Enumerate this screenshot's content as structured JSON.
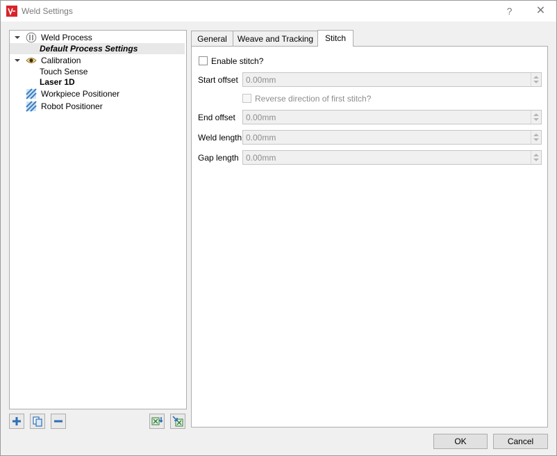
{
  "window": {
    "title": "Weld Settings",
    "help": "?",
    "close": "✕"
  },
  "tree": {
    "items": [
      {
        "label": "Weld Process",
        "icon": "weld-process-icon"
      },
      {
        "label": "Default Process Settings"
      },
      {
        "label": "Calibration",
        "icon": "eye-icon"
      },
      {
        "label": "Touch Sense"
      },
      {
        "label": "Laser 1D"
      },
      {
        "label": "Workpiece Positioner",
        "icon": "positioner-icon"
      },
      {
        "label": "Robot Positioner",
        "icon": "positioner-icon"
      }
    ]
  },
  "tabs": [
    {
      "label": "General"
    },
    {
      "label": "Weave and Tracking"
    },
    {
      "label": "Stitch"
    }
  ],
  "stitch": {
    "enable_label": "Enable stitch?",
    "start_offset_label": "Start offset",
    "start_offset_value": "0.00mm",
    "reverse_label": "Reverse direction of first stitch?",
    "end_offset_label": "End offset",
    "end_offset_value": "0.00mm",
    "weld_length_label": "Weld length",
    "weld_length_value": "0.00mm",
    "gap_length_label": "Gap length",
    "gap_length_value": "0.00mm"
  },
  "buttons": {
    "ok": "OK",
    "cancel": "Cancel"
  },
  "colors": {
    "accent": "#d9232a",
    "positioner": "#3a7fc0"
  }
}
